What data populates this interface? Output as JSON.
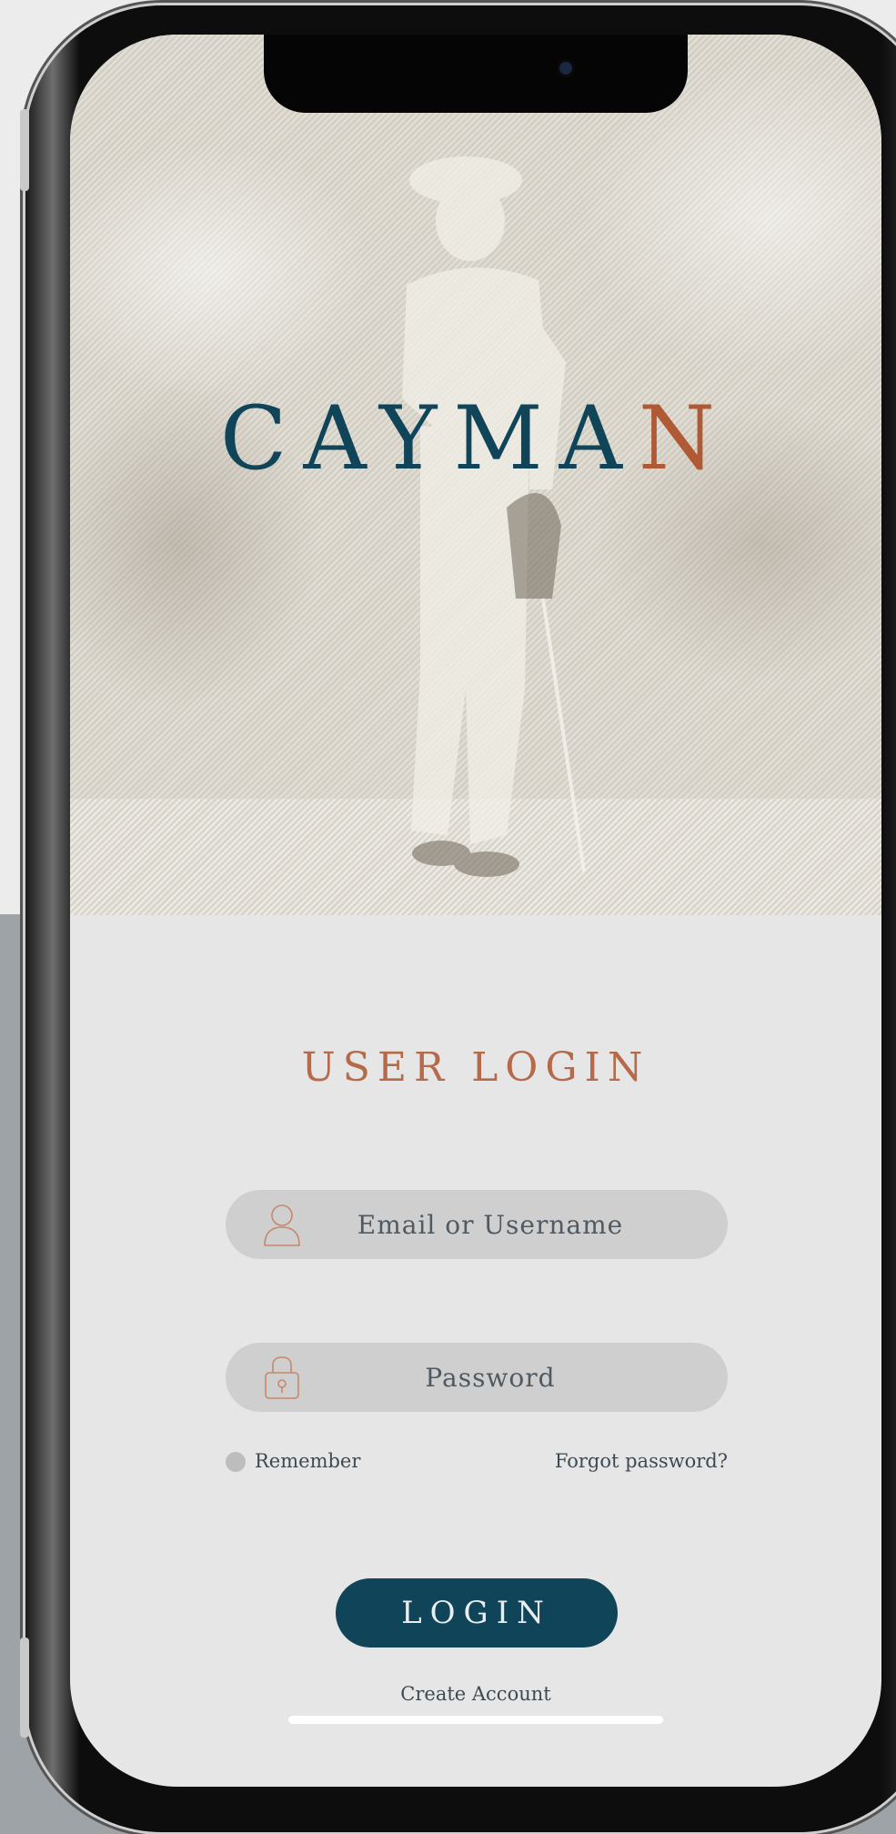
{
  "app": {
    "brand_name": "CAYMA",
    "brand_name_last_letter": "N",
    "brand_color": "#0f4459",
    "accent_color": "#b05a35"
  },
  "login": {
    "title": "USER LOGIN",
    "email_placeholder": "Email or Username",
    "password_placeholder": "Password",
    "remember_label": "Remember",
    "remember_checked": false,
    "forgot_password_label": "Forgot password?",
    "login_button_label": "LOGIN",
    "create_account_label": "Create Account"
  },
  "icons": {
    "email": "user-icon",
    "password": "lock-icon"
  }
}
